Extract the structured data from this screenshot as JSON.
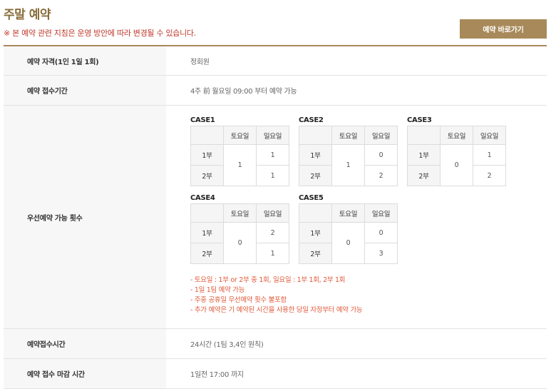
{
  "header": {
    "title": "주말 예약",
    "notice": "※ 본 예약 관련 지침은 운영 방안에 따라 변경될 수 있습니다.",
    "button_label": "예약 바로가기"
  },
  "rows": {
    "eligibility": {
      "label": "예약 자격(1인 1일 1회)",
      "value": "정회원"
    },
    "period": {
      "label": "예약 접수기간",
      "value": "4주 前 월요일 09:00 부터 예약 가능"
    },
    "priority": {
      "label": "우선예약 가능 횟수"
    },
    "time": {
      "label": "예약접수시간",
      "value": "24시간 (1팀 3,4인 원칙)"
    },
    "deadline": {
      "label": "예약 접수 마감 시간",
      "value": "1일전 17:00 까지"
    }
  },
  "table_headers": {
    "sat": "토요일",
    "sun": "일요일",
    "part1": "1부",
    "part2": "2부"
  },
  "cases": [
    {
      "title": "CASE1",
      "sat": "1",
      "sun1": "1",
      "sun2": "1"
    },
    {
      "title": "CASE2",
      "sat": "1",
      "sun1": "0",
      "sun2": "2"
    },
    {
      "title": "CASE3",
      "sat": "0",
      "sun1": "1",
      "sun2": "2"
    },
    {
      "title": "CASE4",
      "sat": "0",
      "sun1": "2",
      "sun2": "1"
    },
    {
      "title": "CASE5",
      "sat": "0",
      "sun1": "0",
      "sun2": "3"
    }
  ],
  "notes": [
    "- 토요일 : 1부 or 2부 중 1회, 일요일 : 1부 1회, 2부 1회",
    "- 1일 1팀 예약 가능",
    "- 주중 공휴일 우선예약 횟수 불포함",
    "- 추가 예약은 기 예약된 시간을 사용한 당일 자정부터 예약 가능"
  ]
}
